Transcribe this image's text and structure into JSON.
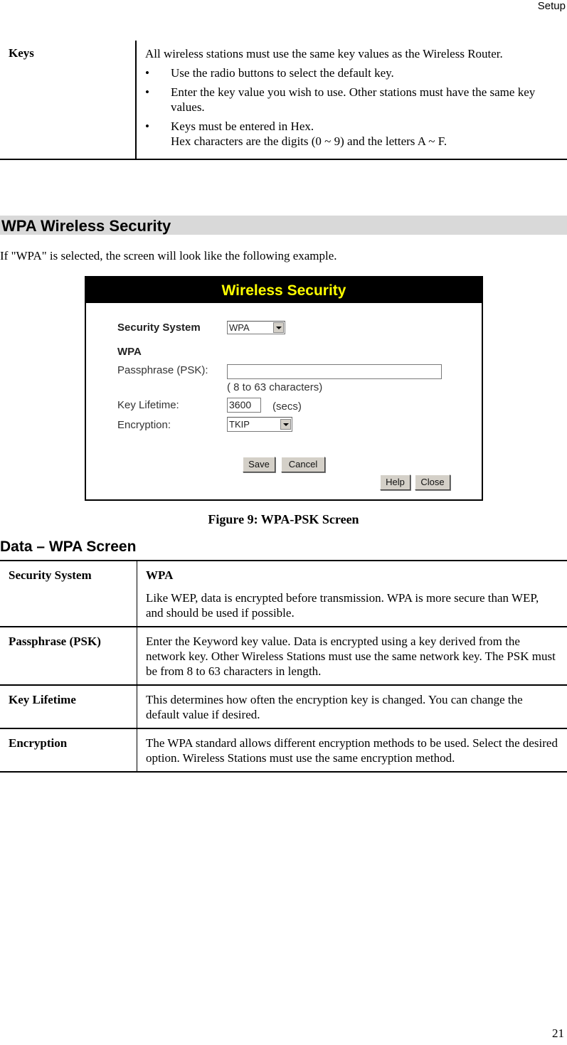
{
  "page_header": "Setup",
  "page_number": "21",
  "keys_table": {
    "label": "Keys",
    "intro": "All wireless stations must use the same key values as the Wireless Router.",
    "bullets": [
      "Use the radio buttons to select the default key.",
      "Enter the key value you wish to use. Other stations must have the same key values.",
      "Keys must be entered in Hex."
    ],
    "bullet3_line2": "Hex characters are the digits (0 ~ 9) and the letters A ~ F.",
    "bullet_glyph": "•"
  },
  "section_heading": "WPA Wireless Security",
  "intro_text": "If \"WPA\" is selected, the screen will look like the following example.",
  "figure": {
    "title": "Wireless Security",
    "title_color": "#ffff00",
    "security_system_label": "Security System",
    "security_system_value": "WPA",
    "wpa_heading": "WPA",
    "passphrase_label": "Passphrase (PSK):",
    "passphrase_value": "",
    "passphrase_hint": "( 8 to 63 characters)",
    "key_lifetime_label": "Key Lifetime:",
    "key_lifetime_value": "3600",
    "key_lifetime_unit": "(secs)",
    "encryption_label": "Encryption:",
    "encryption_value": "TKIP",
    "buttons": {
      "save": "Save",
      "cancel": "Cancel",
      "help": "Help",
      "close": "Close"
    }
  },
  "caption": "Figure 9: WPA-PSK Screen",
  "data_heading": "Data – WPA Screen",
  "data_table": [
    {
      "label": "Security System",
      "title": "WPA",
      "text": "Like WEP, data is encrypted before transmission. WPA is more secure than WEP, and should be used if possible."
    },
    {
      "label": "Passphrase (PSK)",
      "text": "Enter the Keyword key value. Data is encrypted using a key derived from the network key. Other Wireless Stations must use the same network key. The PSK must be from 8 to 63 characters in length."
    },
    {
      "label": "Key Lifetime",
      "text": "This determines how often the encryption key is changed. You can change the default value if desired."
    },
    {
      "label": "Encryption",
      "text": "The WPA standard allows different encryption methods to be used. Select the desired option. Wireless Stations must use the same encryption method."
    }
  ]
}
